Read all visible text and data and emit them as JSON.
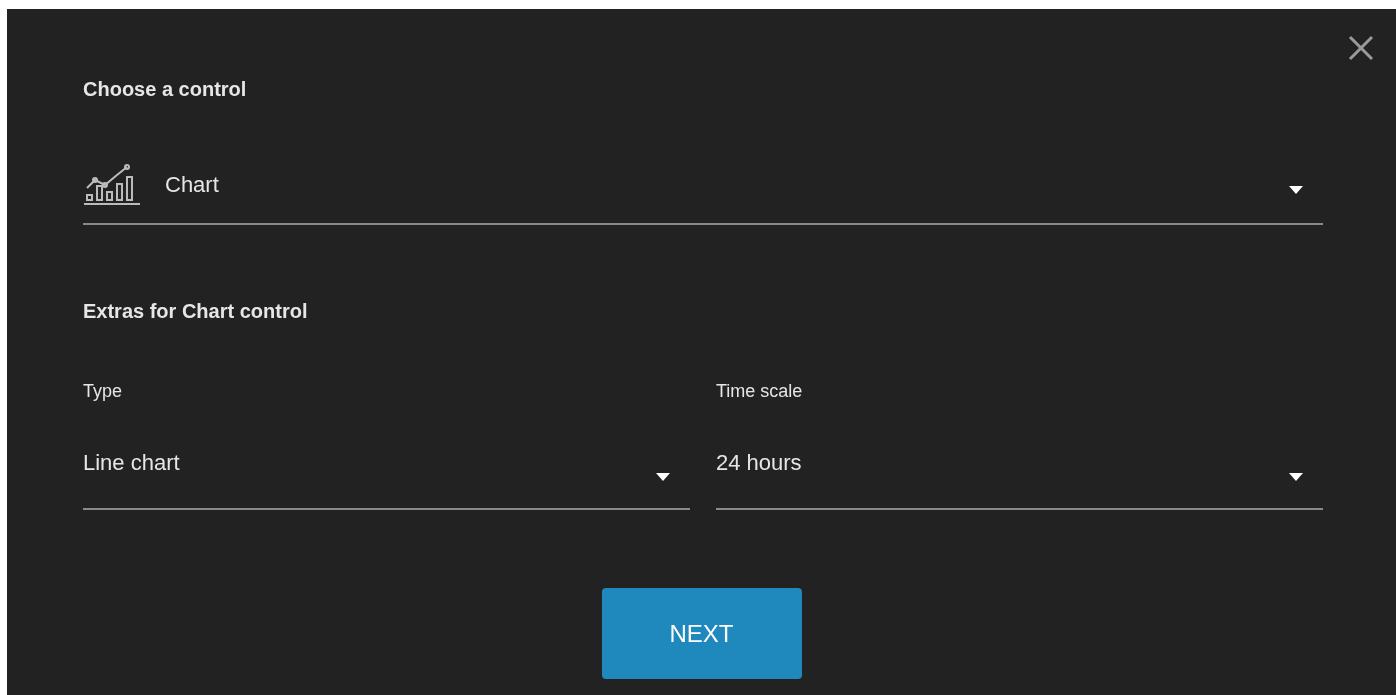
{
  "control_section": {
    "title": "Choose a control",
    "select": {
      "value": "Chart"
    }
  },
  "extras_section": {
    "title": "Extras for Chart control",
    "fields": [
      {
        "label": "Type",
        "value": "Line chart"
      },
      {
        "label": "Time scale",
        "value": "24 hours"
      }
    ]
  },
  "buttons": [
    {
      "label": "NEXT"
    }
  ]
}
